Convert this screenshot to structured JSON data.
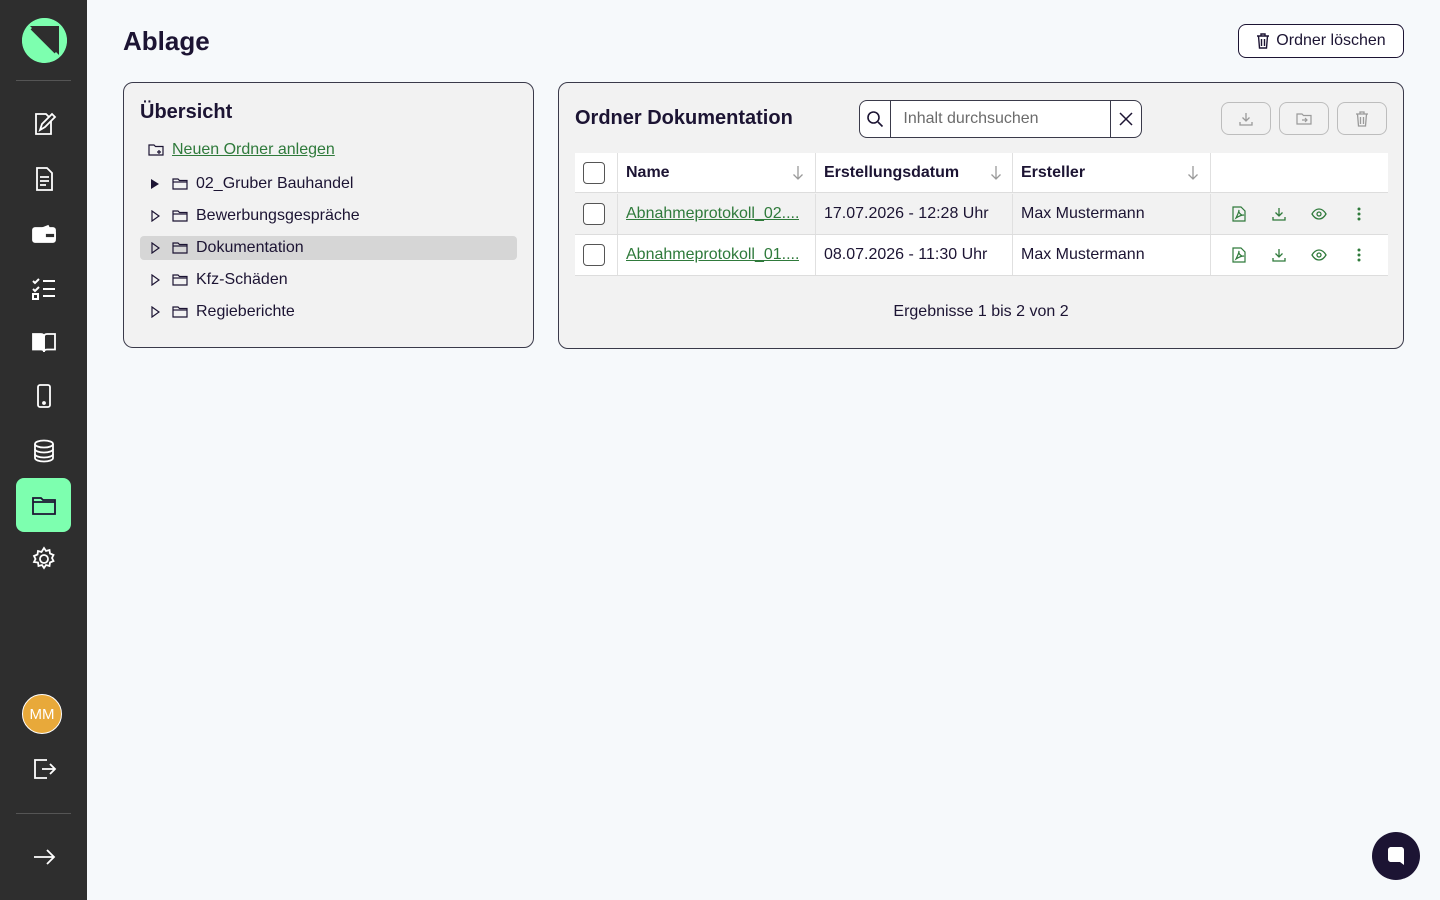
{
  "app": {
    "page_title": "Ablage"
  },
  "header": {
    "delete_folder_label": "Ordner löschen"
  },
  "sidebar": {
    "items": [
      {
        "icon": "edit-document-icon"
      },
      {
        "icon": "document-icon"
      },
      {
        "icon": "wallet-icon"
      },
      {
        "icon": "checklist-icon"
      },
      {
        "icon": "book-icon"
      },
      {
        "icon": "smartphone-icon"
      },
      {
        "icon": "database-icon"
      },
      {
        "icon": "folder-icon",
        "active": true
      },
      {
        "icon": "gear-icon"
      }
    ],
    "user_initials": "MM",
    "accent": "#7dffaf"
  },
  "overview": {
    "title": "Übersicht",
    "new_folder_label": "Neuen Ordner anlegen",
    "folders": [
      {
        "label": "02_Gruber Bauhandel",
        "expanded": true
      },
      {
        "label": "Bewerbungsgespräche"
      },
      {
        "label": "Dokumentation",
        "selected": true
      },
      {
        "label": "Kfz-Schäden"
      },
      {
        "label": "Regieberichte"
      }
    ]
  },
  "folder_view": {
    "title": "Ordner Dokumentation",
    "search": {
      "placeholder": "Inhalt durchsuchen",
      "value": ""
    },
    "columns": [
      "Name",
      "Erstellungsdatum",
      "Ersteller"
    ],
    "rows": [
      {
        "name": "Abnahmeprotokoll_02....",
        "date": "17.07.2026 - 12:28 Uhr",
        "creator": "Max Mustermann"
      },
      {
        "name": "Abnahmeprotokoll_01....",
        "date": "08.07.2026 - 11:30 Uhr",
        "creator": "Max Mustermann"
      }
    ],
    "results_text": "Ergebnisse 1 bis 2 von 2"
  },
  "colors": {
    "link_green": "#2f7a3b",
    "dark": "#1c1433",
    "avatar": "#e8a93a"
  }
}
